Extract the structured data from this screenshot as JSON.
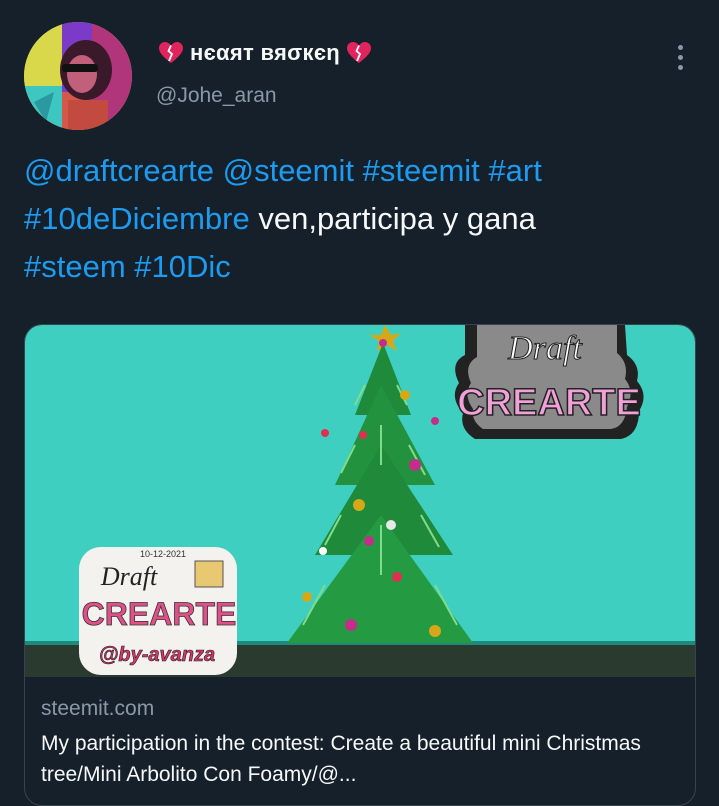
{
  "user": {
    "name": "нєαят вяσкєη",
    "handle": "@Johe_aran",
    "emoji_icon": "broken-heart-icon"
  },
  "tweet": {
    "mention1": "@draftcrearte",
    "mention2": "@steemit",
    "tag1": "#steemit",
    "tag2": "#art",
    "tag3": "#10deDiciembre",
    "body": " ven,participa y gana",
    "tag4": "#steem",
    "tag5": "#10Dic"
  },
  "card": {
    "domain": "steemit.com",
    "title": "My participation in the contest: Create a beautiful mini Christmas tree/Mini Arbolito Con Foamy/@...",
    "image": {
      "sign_small_date": "10-12-2021",
      "sign_small_line1": "Draft",
      "sign_small_line2": "CREARTE",
      "sign_small_line3": "@by-avanza",
      "sign_big_line1": "Draft",
      "sign_big_line2": "CREARTE"
    }
  },
  "colors": {
    "background": "#15202b",
    "link": "#1d9bf0",
    "secondary_text": "#8b98a5",
    "wall": "#3fcfc0"
  }
}
